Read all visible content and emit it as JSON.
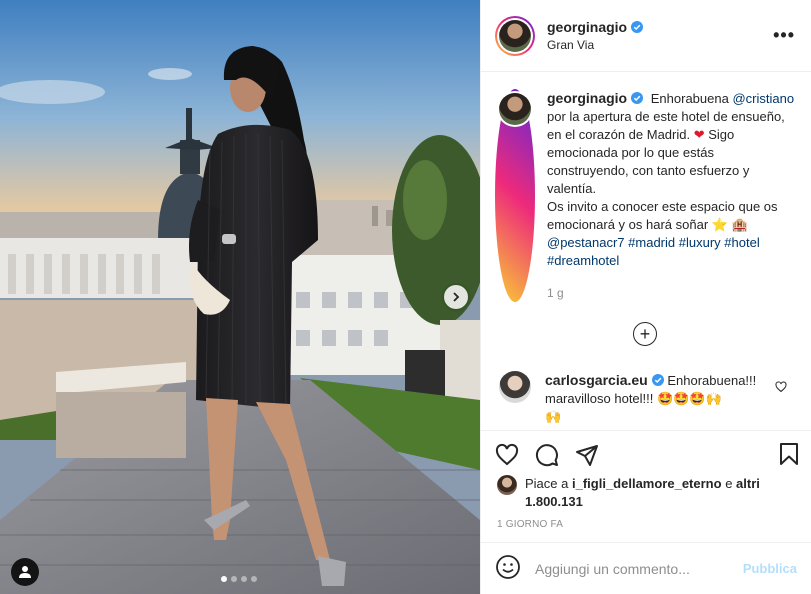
{
  "header": {
    "username": "georginagio",
    "location": "Gran Via",
    "more_icon": "more-horizontal-icon"
  },
  "caption": {
    "username": "georginagio",
    "text_before_mention": "Enhorabuena",
    "mention": "@cristiano",
    "text_line": "por la apertura de este hotel de ensueño, en el corazón de Madrid.",
    "heart": "❤",
    "text_line2": "Sigo emocionada por lo que estás construyendo, con tanto esfuerzo y valentía.",
    "text_line3": "Os invito a conocer este espacio que os emocionará y os hará soñar",
    "emoji_star": "⭐",
    "emoji_hotel": "🏨",
    "mention2": "@pestanacr7",
    "tags": [
      "#madrid",
      "#luxury",
      "#hotel",
      "#dreamhotel"
    ],
    "time": "1 g"
  },
  "comment": {
    "username": "carlosgarcia.eu",
    "text": "Enhorabuena!!! maravilloso hotel!!! 🤩🤩🤩🙌",
    "overflow_emoji": "🙌"
  },
  "actions": {
    "like_icon": "heart-icon",
    "comment_icon": "comment-icon",
    "share_icon": "paper-plane-icon",
    "save_icon": "bookmark-icon"
  },
  "likes": {
    "prefix": "Piace a",
    "user": "i_figli_dellamore_eterno",
    "suffix": "e",
    "others": "altri 1.800.131"
  },
  "date": "1 giorno fa",
  "add_comment": {
    "placeholder": "Aggiungi un commento...",
    "post_label": "Pubblica",
    "post_color": "#b2dffc"
  },
  "media": {
    "carousel_total": 4,
    "carousel_active": 1
  },
  "colors": {
    "link": "#00376b",
    "secondary_text": "#8e8e8e",
    "verified": "#3897f0",
    "heart_red": "#e0182d"
  }
}
